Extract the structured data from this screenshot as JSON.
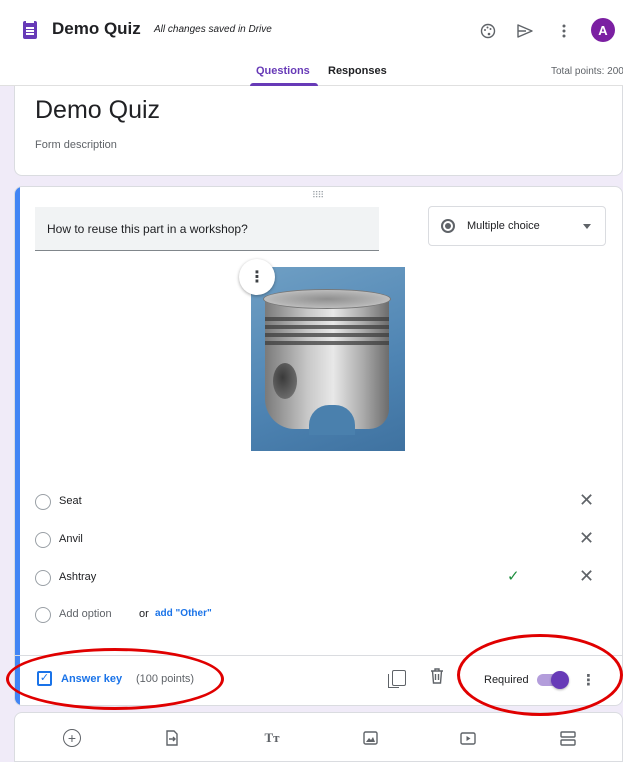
{
  "header": {
    "app_title": "Demo Quiz",
    "save_status": "All changes saved in Drive",
    "icons": [
      "palette-icon",
      "send-icon",
      "more-vert-icon"
    ],
    "avatar_letter": "A"
  },
  "tabs": [
    {
      "label": "Questions",
      "active": true
    },
    {
      "label": "Responses",
      "active": false
    }
  ],
  "total_points": "Total points: 200",
  "form": {
    "title": "Demo Quiz",
    "description_placeholder": "Form description"
  },
  "question": {
    "title": "How to reuse this part in a workshop?",
    "type": "Multiple choice",
    "options": [
      {
        "label": "Seat",
        "correct": false
      },
      {
        "label": "Anvil",
        "correct": false
      },
      {
        "label": "Ashtray",
        "correct": true
      }
    ],
    "add_option": "Add option",
    "or": "or",
    "add_other": "add \"Other\""
  },
  "footer": {
    "answer_key": "Answer key",
    "points": "(100 points)",
    "required_label": "Required",
    "required_on": true
  },
  "toolbar": [
    "add-question",
    "import-questions",
    "add-title",
    "add-image",
    "add-video",
    "add-section"
  ],
  "colors": {
    "accent": "#673ab7",
    "active_bar": "#4285f4",
    "link": "#1a73e8",
    "correct": "#1e8e3e",
    "annotation": "#e00000"
  }
}
